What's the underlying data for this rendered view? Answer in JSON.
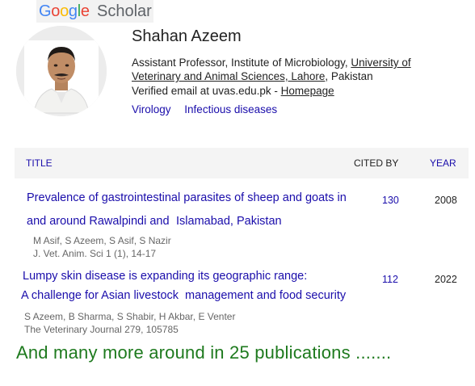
{
  "logo": {
    "letters": [
      "G",
      "o",
      "o",
      "g",
      "l",
      "e"
    ],
    "word2": "Scholar"
  },
  "colors": {
    "link": "#1a0dab",
    "text": "#222222",
    "meta": "#666666",
    "footer": "#1e7a1e",
    "header_bg": "#f4f4f4"
  },
  "profile": {
    "name": "Shahan Azeem",
    "affiliation_prefix": "Assistant Professor, Institute of Microbiology, ",
    "affiliation_link": "University of Veterinary and Animal Sciences, Lahore",
    "affiliation_suffix": ", Pakistan",
    "email_text": "Verified email at uvas.edu.pk - ",
    "homepage_label": "Homepage",
    "interests": [
      "Virology",
      "Infectious diseases"
    ]
  },
  "table": {
    "col_title": "TITLE",
    "col_cited": "CITED BY",
    "col_year": "YEAR",
    "rows": [
      {
        "title_line1": "Prevalence of gastrointestinal parasites of sheep and goats in",
        "title_line2a": "and around Rawalpindi and",
        "title_line2b": "Islamabad, Pakistan",
        "authors": "M Asif, S Azeem, S Asif, S Nazir",
        "journal": "J. Vet. Anim. Sci 1 (1), 14-17",
        "cited_by": "130",
        "year": "2008"
      },
      {
        "title_line1": "Lumpy skin disease is expanding its geographic range:",
        "title_line2a": "A challenge for Asian livestock",
        "title_line2b": "management and food security",
        "authors": "S Azeem, B Sharma, S Shabir, H Akbar, E Venter",
        "journal": "The Veterinary Journal 279, 105785",
        "cited_by": "112",
        "year": "2022"
      }
    ]
  },
  "footer_note": "And many more around in 25 publications ......."
}
